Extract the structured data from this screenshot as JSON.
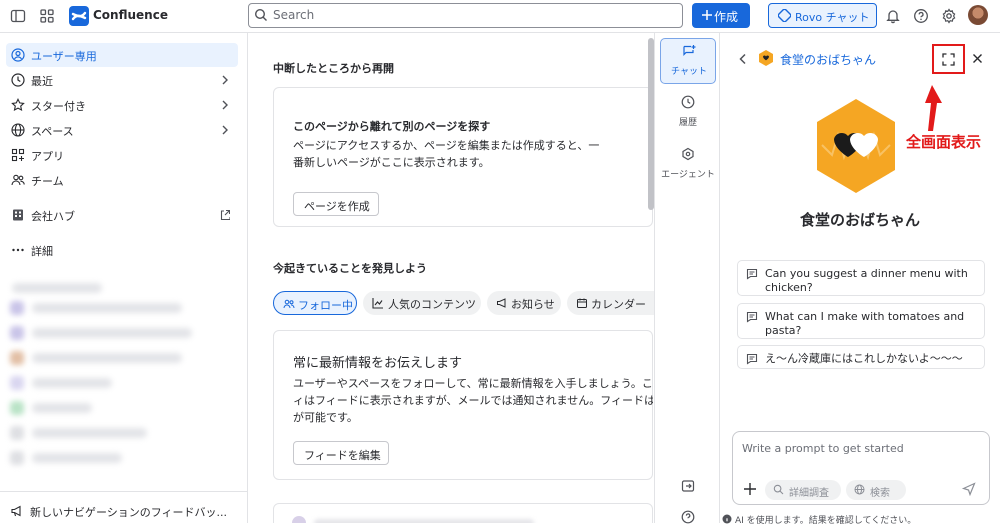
{
  "topbar": {
    "app_name": "Confluence",
    "search_placeholder": "Search",
    "create_label": "作成",
    "rovo_label": "Rovo チャット"
  },
  "sidebar": {
    "items": [
      {
        "label": "ユーザー専用",
        "icon": "user-circle-icon"
      },
      {
        "label": "最近",
        "icon": "clock-icon"
      },
      {
        "label": "スター付き",
        "icon": "star-icon"
      },
      {
        "label": "スペース",
        "icon": "globe-icon"
      },
      {
        "label": "アプリ",
        "icon": "apps-icon"
      },
      {
        "label": "チーム",
        "icon": "people-icon"
      },
      {
        "label": "会社ハブ",
        "icon": "building-icon"
      },
      {
        "label": "詳細",
        "icon": "more-icon"
      }
    ],
    "footer_label": "新しいナビゲーションのフィードバッ..."
  },
  "main": {
    "resume_title": "中断したところから再開",
    "resume_card": {
      "title": "このページから離れて別のページを探す",
      "text": "ページにアクセスするか、ページを編集または作成すると、一\n番新しいページがここに表示されます。",
      "button": "ページを作成"
    },
    "discover_title": "今起きていることを発見しよう",
    "tabs": [
      "フォロー中",
      "人気のコンテンツ",
      "お知らせ",
      "カレンダー"
    ],
    "feed_card": {
      "title": "常に最新情報をお伝えします",
      "text": "ユーザーやスペースをフォローして、常に最新情報を入手しましょう。こ\nィはフィードに表示されますが、メールでは通知されません。フィードは\nが可能です。",
      "button": "フィードを編集"
    }
  },
  "rovo_nav": [
    {
      "label": "チャット",
      "icon": "chat-icon"
    },
    {
      "label": "履歴",
      "icon": "history-icon"
    },
    {
      "label": "エージェント",
      "icon": "agent-icon"
    }
  ],
  "chat": {
    "agent_name": "食堂のおばちゃん",
    "annotation": "全画面表示",
    "suggestions": [
      "Can you suggest a dinner menu with chicken?",
      "What can I make with tomatoes and pasta?",
      "え〜ん冷蔵庫にはこれしかないよ〜〜〜"
    ],
    "prompt_placeholder": "Write a prompt to get started",
    "deep_research_label": "詳細調査",
    "search_label": "検索",
    "disclaimer": "AI を使用します。結果を確認してください。"
  },
  "colors": {
    "brand_blue": "#1868db",
    "agent_orange": "#f5a623",
    "annotation_red": "#e21a1a"
  }
}
